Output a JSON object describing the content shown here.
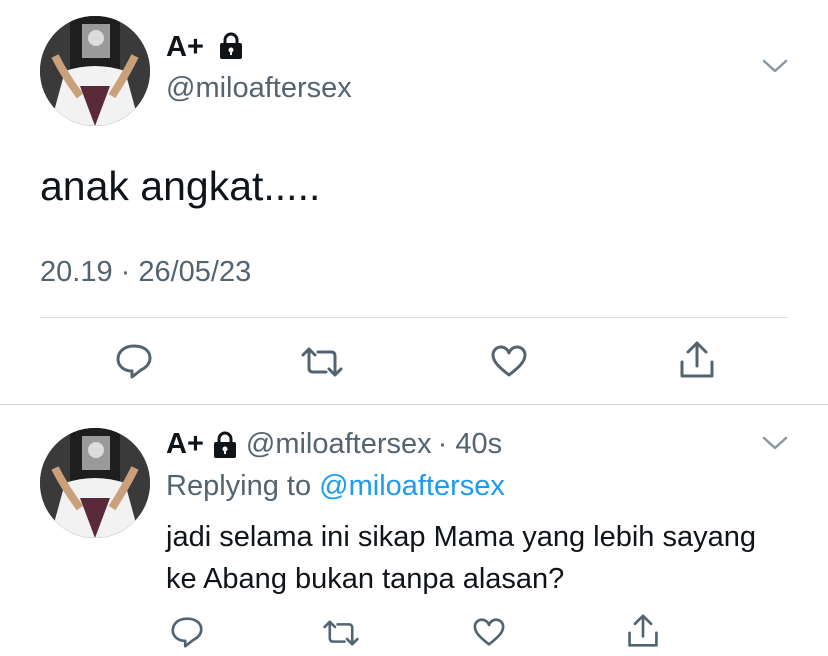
{
  "colors": {
    "accent": "#1d9bf0",
    "muted": "#536471",
    "text": "#0f1419"
  },
  "main_tweet": {
    "name": "A+",
    "handle": "@miloaftersex",
    "text": "anak angkat.....",
    "timestamp": "20.19 · 26/05/23",
    "icons": [
      "lock-icon",
      "chevron-down-icon",
      "reply-icon",
      "retweet-icon",
      "like-icon",
      "share-icon"
    ]
  },
  "reply_tweet": {
    "name": "A+",
    "handle": "@miloaftersex",
    "time": "· 40s",
    "replying_prefix": "Replying to",
    "replying_handle": "@miloaftersex",
    "text": "jadi selama ini sikap Mama yang lebih sayang ke Abang bukan tanpa alasan?"
  }
}
